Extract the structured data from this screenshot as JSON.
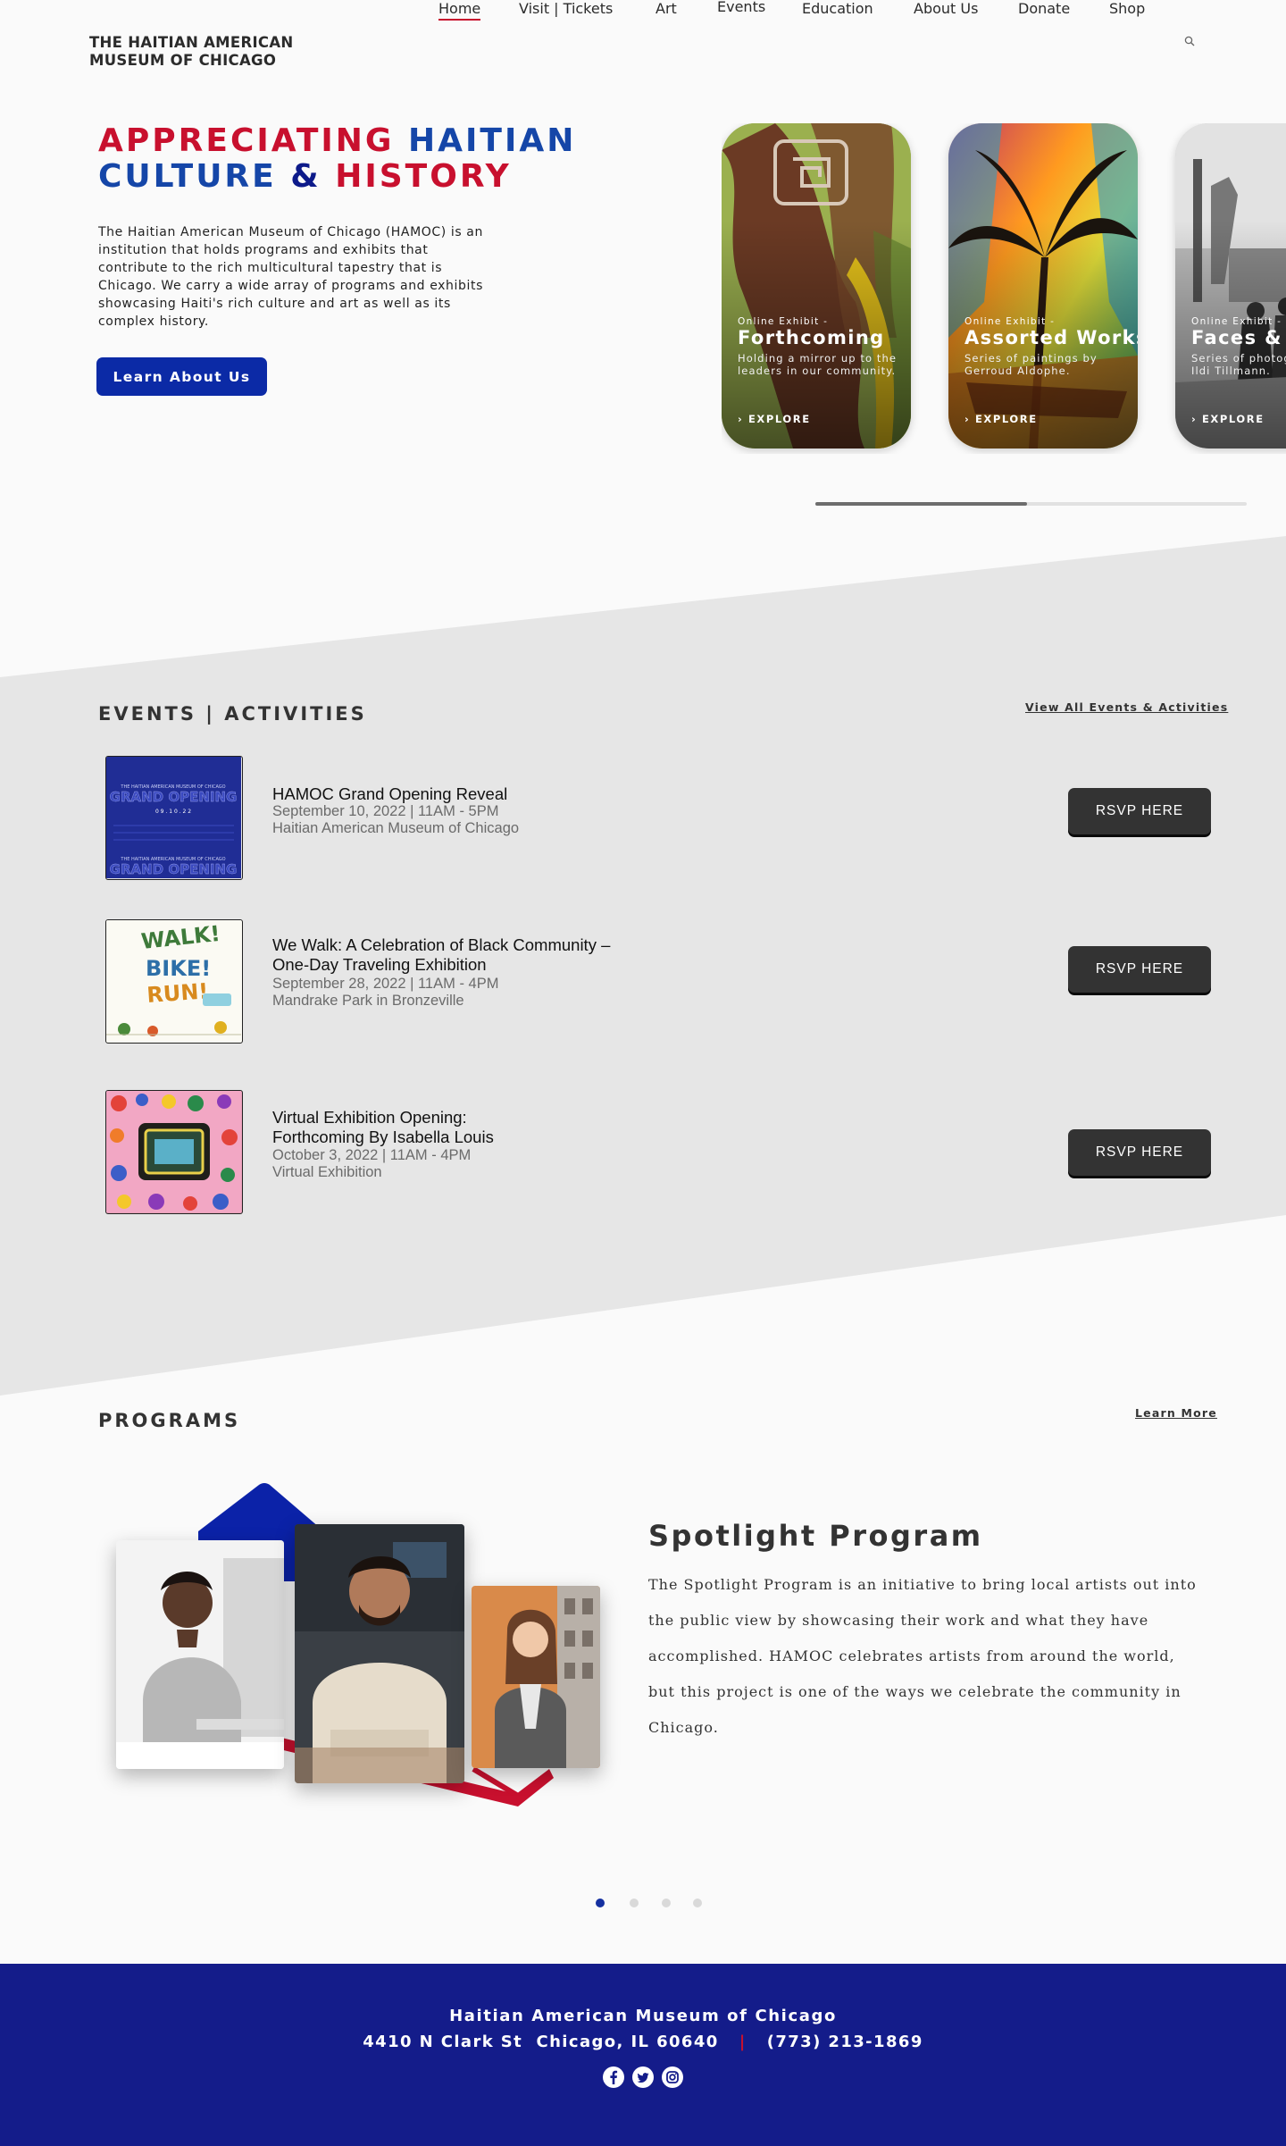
{
  "brand": {
    "logo_line1": "THE HAITIAN AMERICAN",
    "logo_line2": "MUSEUM OF CHICAGO"
  },
  "nav": {
    "items": [
      {
        "label": "Home",
        "active": true
      },
      {
        "label": "Visit | Tickets"
      },
      {
        "label": "Art"
      },
      {
        "label": "Events"
      },
      {
        "label": "Education"
      },
      {
        "label": "About Us"
      },
      {
        "label": "Donate"
      },
      {
        "label": "Shop"
      }
    ],
    "search_icon": "search-icon"
  },
  "hero": {
    "title_w1": "APPRECIATING",
    "title_w2": "HAITIAN",
    "title_w3": "CULTURE",
    "title_amp": "&",
    "title_w4": "HISTORY",
    "body": "The Haitian American Museum of Chicago (HAMOC) is an institution that holds programs and exhibits that contribute to the rich multicultural tapestry that is Chicago. We carry a wide array of programs and exhibits showcasing Haiti's rich culture and art as well as its complex history.",
    "cta": "Learn About Us",
    "cards": [
      {
        "kicker": "Online Exhibit -",
        "title": "Forthcoming",
        "desc": "Holding a mirror up to the leaders in our community.",
        "explore": "EXPLORE"
      },
      {
        "kicker": "Online Exhibit -",
        "title": "Assorted Works",
        "desc": "Series of paintings by Gerroud Aldophe.",
        "explore": "EXPLORE"
      },
      {
        "kicker": "Online Exhibit -",
        "title": "Faces & Places",
        "desc": "Series of photographs by Ildi Tillmann.",
        "explore": "EXPLORE"
      }
    ],
    "carousel_progress": 0.49
  },
  "events": {
    "heading": "EVENTS | ACTIVITIES",
    "view_all": "View All Events & Activities",
    "items": [
      {
        "title_line1": "HAMOC Grand Opening Reveal",
        "title_line2": "",
        "date": "September 10, 2022  |  11AM - 5PM",
        "location": "Haitian American Museum of Chicago",
        "rsvp": "RSVP  HERE",
        "poster_kicker": "THE HAITIAN AMERICAN MUSEUM OF CHICAGO",
        "poster_title": "GRAND OPENING",
        "poster_date": "0 9 . 1 0 . 2 2"
      },
      {
        "title_line1": "We Walk: A Celebration of Black Community –",
        "title_line2": "One-Day Traveling Exhibition",
        "date": "September 28, 2022  |  11AM - 4PM",
        "location": "Mandrake Park in Bronzeville",
        "rsvp": "RSVP  HERE",
        "poster_w1": "WALK!",
        "poster_w2": "BIKE!",
        "poster_w3": "RUN!"
      },
      {
        "title_line1": "Virtual Exhibition Opening:",
        "title_line2": "Forthcoming By Isabella Louis",
        "date": "October 3, 2022  |  11AM - 4PM",
        "location": "Virtual Exhibition",
        "rsvp": "RSVP  HERE"
      }
    ]
  },
  "programs": {
    "heading": "PROGRAMS",
    "learn_more": "Learn More",
    "spotlight_title": "Spotlight Program",
    "spotlight_text": "The Spotlight Program is an initiative to bring local artists out into the public view by showcasing their work and what they have accomplished. HAMOC celebrates artists from around the world, but this project is one of the ways we celebrate the community in Chicago.",
    "slides": 4,
    "active_slide": 1
  },
  "footer": {
    "name": "Haitian American Museum of Chicago",
    "address": "4410 N Clark St  Chicago, IL 60640",
    "separator": "|",
    "phone": "(773) 213-1869",
    "socials": [
      "facebook-icon",
      "twitter-icon",
      "instagram-icon"
    ]
  },
  "colors": {
    "red": "#c8102e",
    "blue": "#1546a8",
    "navy": "#0b2aa6",
    "footer": "#141c8a",
    "band": "#e6e6e6"
  }
}
